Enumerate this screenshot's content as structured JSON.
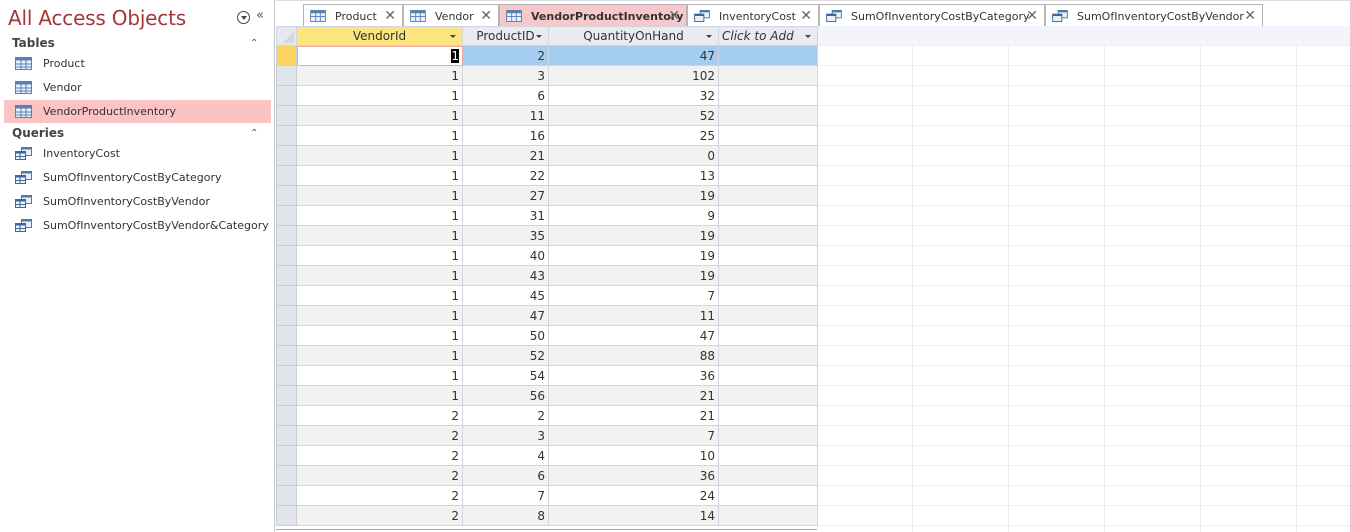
{
  "nav": {
    "title": "All Access Objects",
    "menu_icon": "circle-chevron-down-icon",
    "collapse_icon": "double-chevron-left-icon",
    "groups": [
      {
        "label": "Tables",
        "toggle_icon": "double-chevron-up-icon",
        "items": [
          {
            "label": "Product",
            "icon": "table-icon",
            "selected": false
          },
          {
            "label": "Vendor",
            "icon": "table-icon",
            "selected": false
          },
          {
            "label": "VendorProductInventory",
            "icon": "table-icon",
            "selected": true
          }
        ]
      },
      {
        "label": "Queries",
        "toggle_icon": "double-chevron-up-icon",
        "items": [
          {
            "label": "InventoryCost",
            "icon": "query-icon"
          },
          {
            "label": "SumOfInventoryCostByCategory",
            "icon": "query-icon"
          },
          {
            "label": "SumOfInventoryCostByVendor",
            "icon": "query-icon"
          },
          {
            "label": "SumOfInventoryCostByVendor&Category",
            "icon": "query-icon"
          }
        ]
      }
    ]
  },
  "tabs": [
    {
      "label": "Product",
      "icon": "table-icon",
      "active": false
    },
    {
      "label": "Vendor",
      "icon": "table-icon",
      "active": false
    },
    {
      "label": "VendorProductInventory",
      "icon": "table-icon",
      "active": true
    },
    {
      "label": "InventoryCost",
      "icon": "query-icon",
      "active": false
    },
    {
      "label": "SumOfInventoryCostByCategory",
      "icon": "query-icon",
      "active": false
    },
    {
      "label": "SumOfInventoryCostByVendor",
      "icon": "query-icon",
      "active": false
    }
  ],
  "close_glyph": "✕",
  "datasheet": {
    "columns": [
      "VendorId",
      "ProductID",
      "QuantityOnHand",
      "Click to Add"
    ],
    "rows": [
      [
        1,
        2,
        47
      ],
      [
        1,
        3,
        102
      ],
      [
        1,
        6,
        32
      ],
      [
        1,
        11,
        52
      ],
      [
        1,
        16,
        25
      ],
      [
        1,
        21,
        0
      ],
      [
        1,
        22,
        13
      ],
      [
        1,
        27,
        19
      ],
      [
        1,
        31,
        9
      ],
      [
        1,
        35,
        19
      ],
      [
        1,
        40,
        19
      ],
      [
        1,
        43,
        19
      ],
      [
        1,
        45,
        7
      ],
      [
        1,
        47,
        11
      ],
      [
        1,
        50,
        47
      ],
      [
        1,
        52,
        88
      ],
      [
        1,
        54,
        36
      ],
      [
        1,
        56,
        21
      ],
      [
        2,
        2,
        21
      ],
      [
        2,
        3,
        7
      ],
      [
        2,
        4,
        10
      ],
      [
        2,
        6,
        36
      ],
      [
        2,
        7,
        24
      ],
      [
        2,
        8,
        14
      ]
    ],
    "current_row": 0,
    "active_column": "VendorId"
  },
  "colors": {
    "accent": "#a4373a",
    "selected_nav": "#fbc3c3",
    "active_tab": "#f7c8c9",
    "active_header": "#fde57d",
    "selection": "#a5cdf0"
  }
}
